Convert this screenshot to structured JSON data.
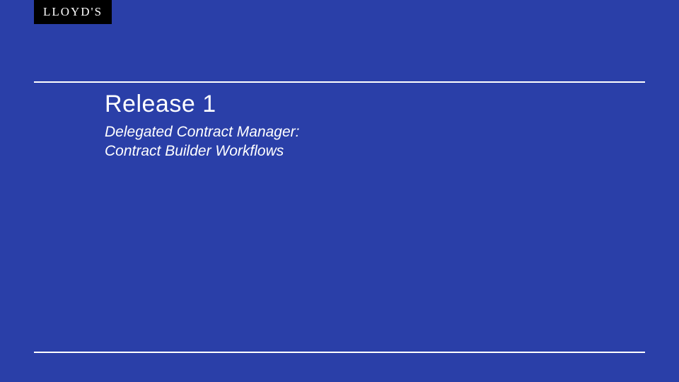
{
  "logo": {
    "text": "LLOYD'S"
  },
  "slide": {
    "title": "Release 1",
    "subtitle_line1": "Delegated Contract Manager:",
    "subtitle_line2": "Contract Builder Workflows"
  }
}
